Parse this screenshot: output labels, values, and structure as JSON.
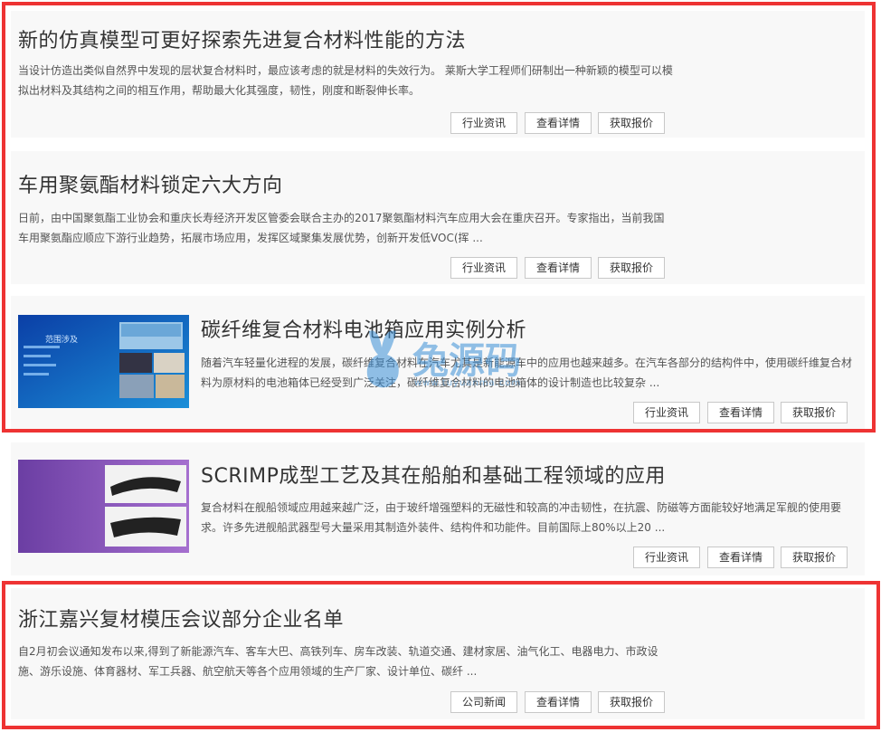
{
  "articles": [
    {
      "title": "新的仿真模型可更好探索先进复合材料性能的方法",
      "desc": "当设计仿造出类似自然界中发现的层状复合材料时，最应该考虑的就是材料的失效行为。 莱斯大学工程师们研制出一种新颖的模型可以模拟出材料及其结构之间的相互作用，帮助最大化其强度，韧性，刚度和断裂伸长率。",
      "tag": "行业资讯",
      "detail": "查看详情",
      "quote": "获取报价"
    },
    {
      "title": "车用聚氨酯材料锁定六大方向",
      "desc": "日前，由中国聚氨酯工业协会和重庆长寿经济开发区管委会联合主办的2017聚氨酯材料汽车应用大会在重庆召开。专家指出，当前我国车用聚氨酯应顺应下游行业趋势，拓展市场应用，发挥区域聚集发展优势，创新开发低VOC(挥 ...",
      "tag": "行业资讯",
      "detail": "查看详情",
      "quote": "获取报价"
    },
    {
      "title": "碳纤维复合材料电池箱应用实例分析",
      "desc": "随着汽车轻量化进程的发展，碳纤维复合材料在汽车尤其是新能源车中的应用也越来越多。在汽车各部分的结构件中，使用碳纤维复合材料为原材料的电池箱体已经受到广泛关注，碳纤维复合材料的电池箱体的设计制造也比较复杂 ...",
      "tag": "行业资讯",
      "detail": "查看详情",
      "quote": "获取报价",
      "thumb_text": "范围涉及"
    },
    {
      "title": "SCRIMP成型工艺及其在船舶和基础工程领域的应用",
      "desc": "复合材料在舰船领域应用越来越广泛，由于玻纤增强塑料的无磁性和较高的冲击韧性，在抗震、防磁等方面能较好地满足军舰的使用要求。许多先进舰船武器型号大量采用其制造外装件、结构件和功能件。目前国际上80%以上20 ...",
      "tag": "行业资讯",
      "detail": "查看详情",
      "quote": "获取报价"
    },
    {
      "title": "浙江嘉兴复材模压会议部分企业名单",
      "desc": "自2月初会议通知发布以来,得到了新能源汽车、客车大巴、高铁列车、房车改装、轨道交通、建材家居、油气化工、电器电力、市政设施、游乐设施、体育器材、军工兵器、航空航天等各个应用领域的生产厂家、设计单位、碳纤 ...",
      "tag": "公司新闻",
      "detail": "查看详情",
      "quote": "获取报价"
    }
  ],
  "watermark": {
    "text": "兔源码",
    "sub": "www.tuyuanma.com"
  },
  "colors": {
    "highlight_border": "#ee3333",
    "card_bg": "#f8f8f8",
    "watermark": "#3a8fd6"
  }
}
